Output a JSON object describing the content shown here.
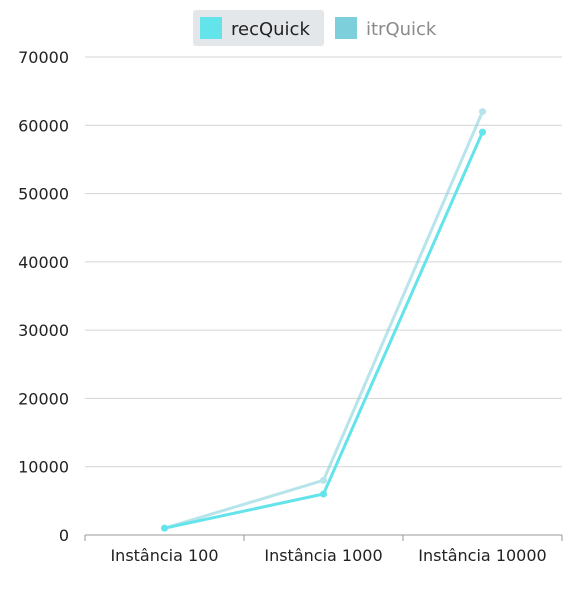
{
  "chart_data": {
    "type": "line",
    "title": "",
    "xlabel": "",
    "ylabel": "",
    "categories": [
      "Instância 100",
      "Instância 1000",
      "Instância 10000"
    ],
    "ylim": [
      0,
      70000
    ],
    "yticks": [
      0,
      10000,
      20000,
      30000,
      40000,
      50000,
      60000,
      70000
    ],
    "grid": true,
    "legend_position": "top-center",
    "series": [
      {
        "name": "recQuick",
        "color": "#63e3ea",
        "values": [
          1000,
          6000,
          59000
        ],
        "active": true
      },
      {
        "name": "itrQuick",
        "color": "#7ecfdc",
        "values": [
          1000,
          8000,
          62000
        ],
        "active": false
      }
    ]
  }
}
